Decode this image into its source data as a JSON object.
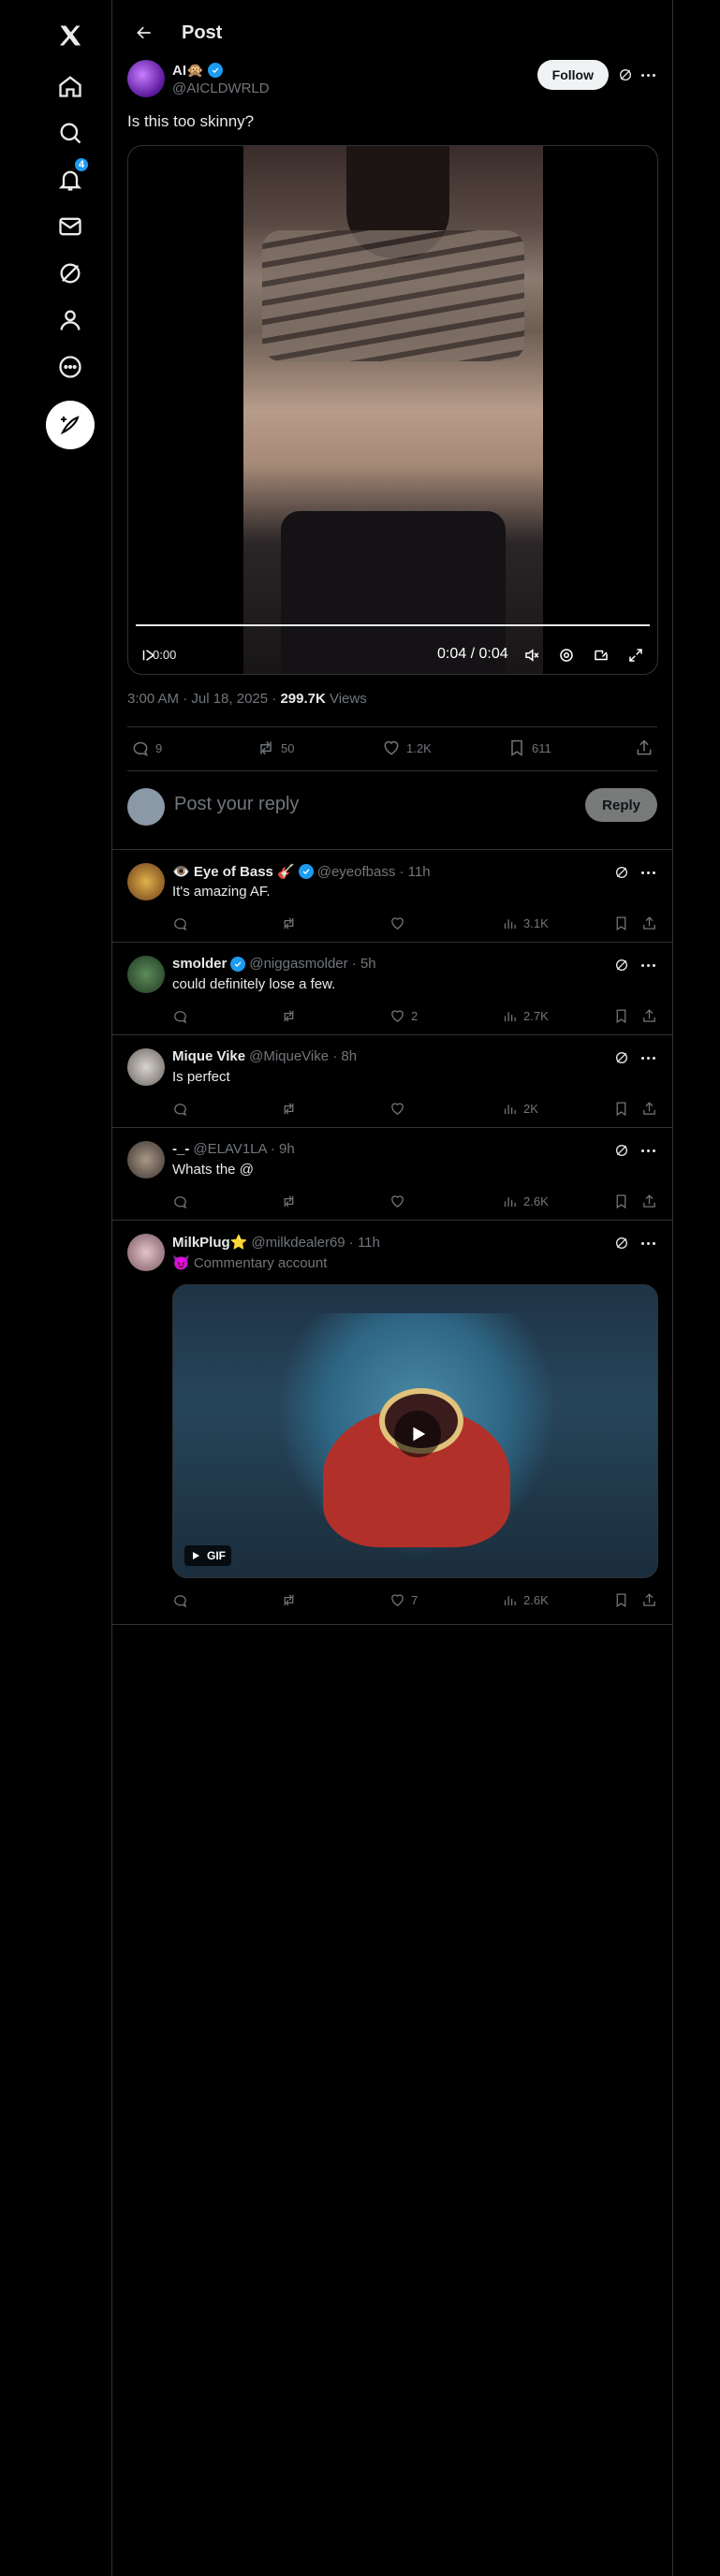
{
  "header": {
    "title": "Post"
  },
  "sidebar": {
    "notifications_badge": "4"
  },
  "post": {
    "author_name": "AI🙊",
    "author_handle": "@AICLDWRLD",
    "follow_label": "Follow",
    "text": "Is this too skinny?",
    "video": {
      "elapsed_left": "0:00",
      "time": "0:04 / 0:04",
      "progress": 1.0
    },
    "meta_time": "3:00 AM · Jul 18, 2025 · ",
    "views_count": "299.7K",
    "views_label": " Views",
    "stats": {
      "replies": "9",
      "reposts": "50",
      "likes": "1.2K",
      "bookmarks": "611"
    }
  },
  "reply_box": {
    "placeholder": "Post your reply",
    "button": "Reply"
  },
  "replies": [
    {
      "name": "👁️ Eye of Bass 🎸",
      "handle": "@eyeofbass · 11h",
      "text": "It's amazing AF.",
      "replies": "",
      "reposts": "",
      "likes": "",
      "views": "3.1K",
      "verified": true
    },
    {
      "name": "smolder",
      "handle": "@niggasmolder · 5h",
      "text": "could definitely lose a few.",
      "replies": "",
      "reposts": "",
      "likes": "2",
      "views": "2.7K",
      "verified": true
    },
    {
      "name": "Mique Vike",
      "handle": "@MiqueVike · 8h",
      "text": "Is perfect",
      "replies": "",
      "reposts": "",
      "likes": "",
      "views": "2K",
      "verified": false
    },
    {
      "name": "-_-",
      "handle": "@ELAV1LA · 9h",
      "text": "Whats the @",
      "replies": "",
      "reposts": "",
      "likes": "",
      "views": "2.6K",
      "verified": false
    },
    {
      "name": "MilkPlug⭐",
      "handle": "@milkdealer69 · 11h",
      "text": "😈 Commentary account",
      "replies": "",
      "reposts": "",
      "likes": "7",
      "views": "2.6K",
      "verified": false,
      "gif_label": "GIF"
    }
  ],
  "colors": {
    "accent": "#1d9bf0",
    "background": "#000000",
    "muted": "#71767b"
  }
}
